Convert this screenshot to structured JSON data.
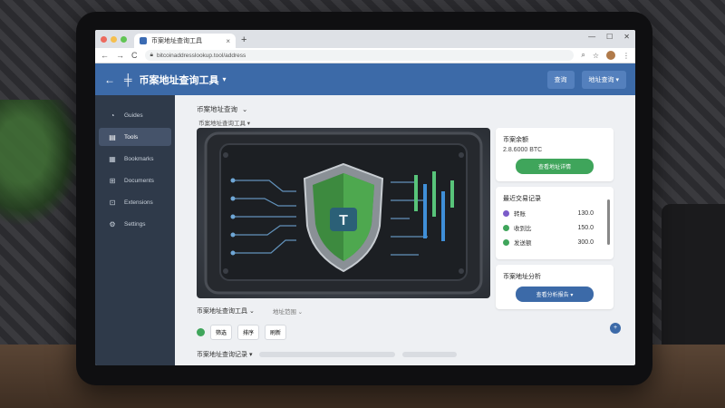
{
  "browser": {
    "tab_title": "币案地址查询工具",
    "tab_close": "×",
    "new_tab": "+",
    "url": "bitcoinaddresslookup.tool/address",
    "window_controls": [
      "—",
      "☐",
      "✕"
    ],
    "nav": {
      "back": "←",
      "forward": "→",
      "reload": "C"
    },
    "addr_icons": [
      "⌕",
      "☆"
    ],
    "traffic_colors": [
      "#ed6a5e",
      "#f5bf4f",
      "#61c554"
    ]
  },
  "header": {
    "back": "←",
    "title": "币案地址查询工具",
    "chevron": "▾",
    "buttons": [
      "查询",
      "地址查询 ▾"
    ],
    "color": "#3c6aa8"
  },
  "sidebar": {
    "items": [
      {
        "icon": "gauge-icon",
        "glyph": "◔",
        "label": "Guides"
      },
      {
        "icon": "list-icon",
        "glyph": "▤",
        "label": "Tools",
        "active": true
      },
      {
        "icon": "book-icon",
        "glyph": "▦",
        "label": "Bookmarks"
      },
      {
        "icon": "docs-icon",
        "glyph": "⊞",
        "label": "Documents"
      },
      {
        "icon": "ext-icon",
        "glyph": "⊡",
        "label": "Extensions"
      },
      {
        "icon": "gear-icon",
        "glyph": "⚙",
        "label": "Settings"
      }
    ]
  },
  "main": {
    "section_title": "币案地址查询",
    "section_chevron": "⌄",
    "subtitle": "币案地址查询工具 ▾",
    "cards": {
      "balance": {
        "title": "币案余额",
        "value": "2.8.6000 BTC",
        "button": "查看地址详情"
      },
      "list": {
        "title": "最近交易记录",
        "rows": [
          {
            "label": "转账",
            "value": "130.0",
            "color": "#7b5cc9"
          },
          {
            "label": "收到比",
            "value": "150.0",
            "color": "#3fa55b"
          },
          {
            "label": "发送额",
            "value": "300.0",
            "color": "#3fa55b"
          }
        ]
      },
      "action": {
        "title": "币案地址分析",
        "button": "查看分析报告 ▾"
      }
    },
    "bottom": {
      "title": "币案地址查询工具",
      "title_chevron": "⌄",
      "filter": "地址范围",
      "filter_chevron": "⌄",
      "chips": [
        "筛选",
        "排序",
        "刷新"
      ],
      "fab": "+",
      "footer_title": "币案地址查询记录 ▾"
    }
  }
}
